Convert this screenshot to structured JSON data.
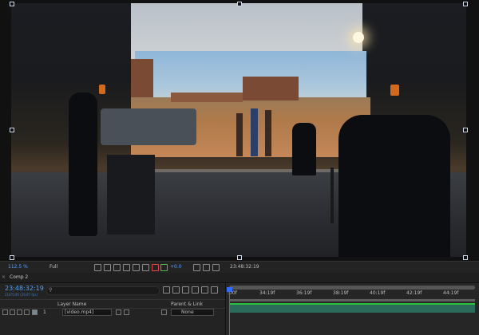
{
  "viewer": {
    "zoom": "112.5 %",
    "resolution": "Full",
    "timecode_label": "23:48:32:19",
    "plus_value": "+0.0"
  },
  "comp_tab": {
    "close": "×",
    "label": "Comp 2"
  },
  "timeline": {
    "current_time": "23:48:32:19",
    "sub_time": "2187249 (29.97 fps)",
    "search_icon": "search-icon",
    "columns": {
      "layer_name": "Layer Name",
      "parent_link": "Parent & Link"
    },
    "layers": [
      {
        "number": "1",
        "name": "[video.mp4]",
        "parent": "None"
      }
    ],
    "ruler_ticks": [
      ":00f",
      "34:19f",
      "36:19f",
      "38:19f",
      "40:19f",
      "42:19f",
      "44:19f"
    ]
  },
  "colors": {
    "accent_blue": "#4aa3ff",
    "track_green": "#2fbf3a",
    "track_fill": "#2a6b5a",
    "playhead": "#2f6cff"
  }
}
